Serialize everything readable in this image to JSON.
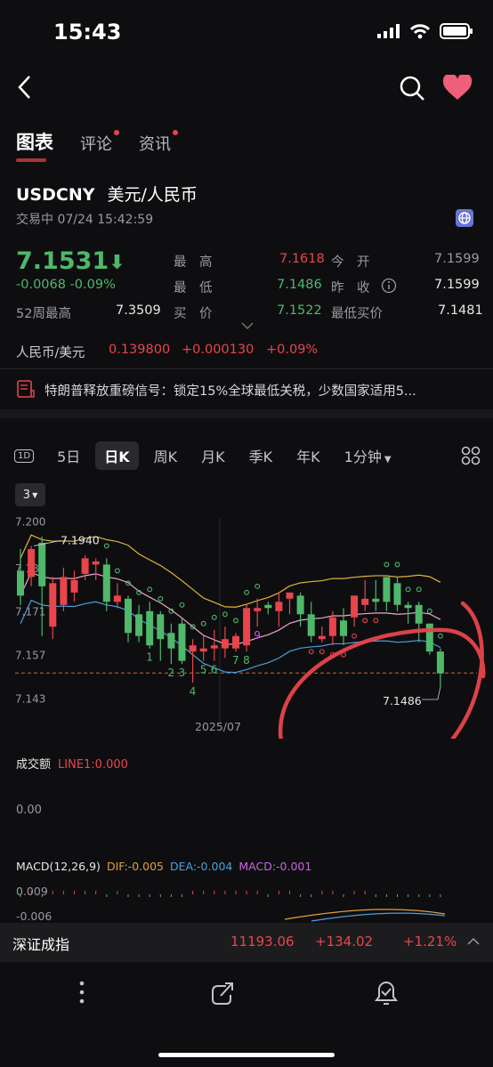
{
  "status_bar": {
    "time": "15:43"
  },
  "tabs": [
    {
      "label": "图表",
      "active": true
    },
    {
      "label": "评论",
      "dot": true
    },
    {
      "label": "资讯",
      "dot": true
    }
  ],
  "instrument": {
    "symbol": "USDCNY",
    "name": "美元/人民币",
    "trade_status": "交易中 07/24 15:42:59",
    "price": "7.1531",
    "change": "-0.0068 -0.09%",
    "stats": {
      "high_label": "最　高",
      "high": "7.1618",
      "open_label": "今　开",
      "open": "7.1599",
      "low_label": "最　低",
      "low": "7.1486",
      "prev_close_label": "昨　收",
      "prev_close": "7.1599",
      "week52_high_label": "52周最高",
      "week52_high": "7.3509",
      "bid_label": "买　价",
      "bid": "7.1522",
      "lowest_ask_label": "最低买价",
      "lowest_ask": "7.1481"
    },
    "reverse_pair": {
      "label": "人民币/美元",
      "price": "0.139800",
      "change": "+0.000130",
      "pct": "+0.09%"
    },
    "news": "特朗普释放重磅信号：锁定15%全球最低关税，少数国家适用5..."
  },
  "periods": [
    {
      "label": "1D",
      "icon": true
    },
    {
      "label": "5日"
    },
    {
      "label": "日K",
      "selected": true
    },
    {
      "label": "周K"
    },
    {
      "label": "月K"
    },
    {
      "label": "季K"
    },
    {
      "label": "年K"
    },
    {
      "label": "1分钟",
      "dropdown": true
    }
  ],
  "chart": {
    "selector": "3",
    "annotations": {
      "high_label": "7.1940",
      "low_label": "7.1486",
      "date_label": "2025/07"
    },
    "volume": {
      "title": "成交额",
      "line": "LINE1:0.000",
      "value": "0.00"
    },
    "macd": {
      "title": "MACD(12,26,9)",
      "dif": "DIF:-0.005",
      "dea": "DEA:-0.004",
      "macd": "MACD:-0.001",
      "top": "0.009",
      "bottom": "-0.006"
    }
  },
  "chart_data": {
    "type": "candlestick",
    "yticks": [
      "7.200",
      "7.185",
      "7.171",
      "7.157",
      "7.143"
    ],
    "ylim": [
      7.14,
      7.203
    ],
    "xticks": [
      "2025/07"
    ],
    "reference_line": 7.1531,
    "candles": [
      {
        "o": 7.186,
        "c": 7.178,
        "h": 7.193,
        "l": 7.175
      },
      {
        "o": 7.184,
        "c": 7.193,
        "h": 7.194,
        "l": 7.181
      },
      {
        "o": 7.195,
        "c": 7.181,
        "h": 7.197,
        "l": 7.165
      },
      {
        "o": 7.168,
        "c": 7.182,
        "h": 7.184,
        "l": 7.164
      },
      {
        "o": 7.175,
        "c": 7.184,
        "h": 7.187,
        "l": 7.173
      },
      {
        "o": 7.179,
        "c": 7.183,
        "h": 7.186,
        "l": 7.176
      },
      {
        "o": 7.185,
        "c": 7.19,
        "h": 7.191,
        "l": 7.183
      },
      {
        "o": 7.188,
        "c": 7.189,
        "h": 7.19,
        "l": 7.183
      },
      {
        "o": 7.188,
        "c": 7.176,
        "h": 7.19,
        "l": 7.173
      },
      {
        "o": 7.176,
        "c": 7.178,
        "h": 7.182,
        "l": 7.174
      },
      {
        "o": 7.177,
        "c": 7.166,
        "h": 7.178,
        "l": 7.163
      },
      {
        "o": 7.172,
        "c": 7.165,
        "h": 7.175,
        "l": 7.163
      },
      {
        "o": 7.173,
        "c": 7.162,
        "h": 7.176,
        "l": 7.161
      },
      {
        "o": 7.172,
        "c": 7.164,
        "h": 7.173,
        "l": 7.157
      },
      {
        "o": 7.166,
        "c": 7.161,
        "h": 7.169,
        "l": 7.156
      },
      {
        "o": 7.169,
        "c": 7.157,
        "h": 7.171,
        "l": 7.156
      },
      {
        "o": 7.16,
        "c": 7.162,
        "h": 7.164,
        "l": 7.15
      },
      {
        "o": 7.16,
        "c": 7.161,
        "h": 7.165,
        "l": 7.157
      },
      {
        "o": 7.161,
        "c": 7.162,
        "h": 7.167,
        "l": 7.157
      },
      {
        "o": 7.161,
        "c": 7.164,
        "h": 7.168,
        "l": 7.158
      },
      {
        "o": 7.161,
        "c": 7.165,
        "h": 7.166,
        "l": 7.16
      },
      {
        "o": 7.162,
        "c": 7.174,
        "h": 7.175,
        "l": 7.16
      },
      {
        "o": 7.173,
        "c": 7.174,
        "h": 7.177,
        "l": 7.168
      },
      {
        "o": 7.175,
        "c": 7.174,
        "h": 7.176,
        "l": 7.172
      },
      {
        "o": 7.173,
        "c": 7.176,
        "h": 7.179,
        "l": 7.168
      },
      {
        "o": 7.177,
        "c": 7.179,
        "h": 7.179,
        "l": 7.172
      },
      {
        "o": 7.178,
        "c": 7.172,
        "h": 7.179,
        "l": 7.168
      },
      {
        "o": 7.172,
        "c": 7.165,
        "h": 7.176,
        "l": 7.163
      },
      {
        "o": 7.164,
        "c": 7.165,
        "h": 7.168,
        "l": 7.163
      },
      {
        "o": 7.165,
        "c": 7.171,
        "h": 7.173,
        "l": 7.162
      },
      {
        "o": 7.17,
        "c": 7.165,
        "h": 7.174,
        "l": 7.162
      },
      {
        "o": 7.171,
        "c": 7.178,
        "h": 7.178,
        "l": 7.168
      },
      {
        "o": 7.175,
        "c": 7.177,
        "h": 7.183,
        "l": 7.173
      },
      {
        "o": 7.177,
        "c": 7.176,
        "h": 7.183,
        "l": 7.173
      },
      {
        "o": 7.184,
        "c": 7.176,
        "h": 7.184,
        "l": 7.173
      },
      {
        "o": 7.182,
        "c": 7.175,
        "h": 7.184,
        "l": 7.173
      },
      {
        "o": 7.175,
        "c": 7.174,
        "h": 7.176,
        "l": 7.169
      },
      {
        "o": 7.175,
        "c": 7.169,
        "h": 7.176,
        "l": 7.163
      },
      {
        "o": 7.169,
        "c": 7.16,
        "h": 7.169,
        "l": 7.159
      },
      {
        "o": 7.16,
        "c": 7.153,
        "h": 7.161,
        "l": 7.1486
      }
    ],
    "counts": [
      {
        "i": 12,
        "t": "1"
      },
      {
        "i": 14,
        "t": "2"
      },
      {
        "i": 15,
        "t": "3"
      },
      {
        "i": 16,
        "t": "4"
      },
      {
        "i": 17,
        "t": "5"
      },
      {
        "i": 18,
        "t": "6"
      },
      {
        "i": 20,
        "t": "7"
      },
      {
        "i": 21,
        "t": "8"
      },
      {
        "i": 22,
        "t": "9"
      }
    ]
  },
  "bottom_ticker": {
    "name": "深证成指",
    "price": "11193.06",
    "change": "+134.02",
    "pct": "+1.21%"
  },
  "colors": {
    "up": "#e8454d",
    "down": "#4fb86a",
    "background": "#0e0e10",
    "ma_yellow": "#e0b43b",
    "ma_pink": "#f0a6c9",
    "ma_blue": "#4a9fe0",
    "annotation_red": "#e8454d"
  }
}
